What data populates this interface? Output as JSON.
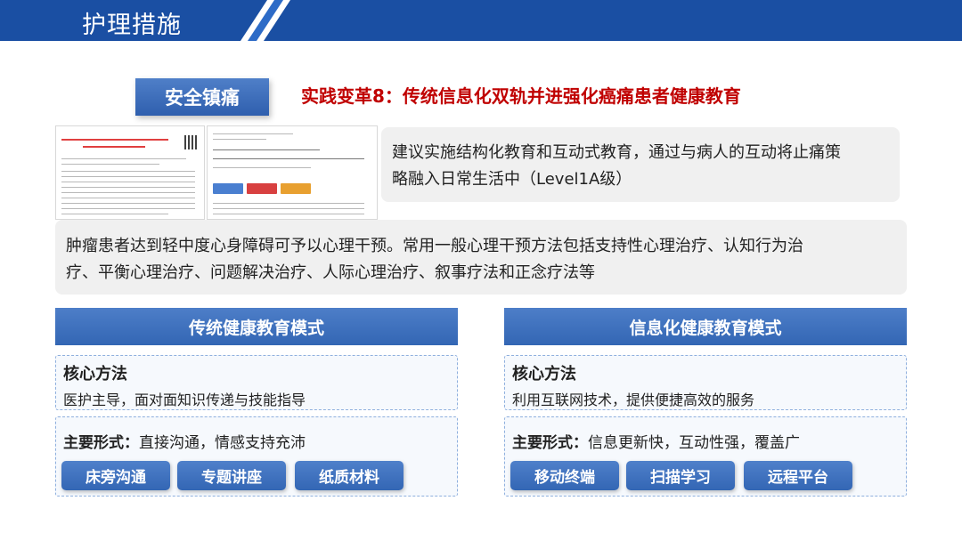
{
  "header": {
    "title": "护理措施"
  },
  "tag": "安全镇痛",
  "subtitle": "实践变革8：传统信息化双轨并进强化癌痛患者健康教育",
  "recommendation": {
    "line1": "建议实施结构化教育和互动式教育，通过与病人的互动将止痛策",
    "line2": "略融入日常生活中（Level1A级）"
  },
  "psychology": {
    "line1": "肿瘤患者达到轻中度心身障碍可予以心理干预。常用一般心理干预方法包括支持性心理治疗、认知行为治",
    "line2": "疗、平衡心理治疗、问题解决治疗、人际心理治疗、叙事疗法和正念疗法等"
  },
  "traditional": {
    "title": "传统健康教育模式",
    "core_label": "核心方法",
    "core_text": "医护主导，面对面知识传递与技能指导",
    "forms_label": "主要形式：",
    "forms_text": "直接沟通，情感支持充沛",
    "pills": [
      "床旁沟通",
      "专题讲座",
      "纸质材料"
    ]
  },
  "information": {
    "title": "信息化健康教育模式",
    "core_label": "核心方法",
    "core_text": "利用互联网技术，提供便捷高效的服务",
    "forms_label": "主要形式：",
    "forms_text": "信息更新快，互动性强，覆盖广",
    "pills": [
      "移动终端",
      "扫描学习",
      "远程平台"
    ]
  },
  "colors": {
    "primary": "#2f62b0",
    "banner": "#1a4fa3",
    "accent_red": "#c00000"
  }
}
